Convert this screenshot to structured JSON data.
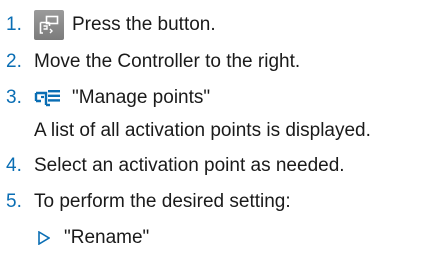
{
  "colors": {
    "accent": "#0a6eb4",
    "icon_fill": "#8a8a8a",
    "text": "#1a1a1a"
  },
  "steps": [
    {
      "number": "1.",
      "icon": "parking-assist-button-icon",
      "text": "Press the button."
    },
    {
      "number": "2.",
      "text": "Move the Controller to the right."
    },
    {
      "number": "3.",
      "icon": "parking-menu-icon",
      "text": "\"Manage points\""
    },
    {
      "number": "4.",
      "text": "Select an activation point as needed."
    },
    {
      "number": "5.",
      "text": "To perform the desired setting:"
    }
  ],
  "step3_note": "A list of all activation points is displayed.",
  "substeps": [
    {
      "icon": "triangle-bullet-icon",
      "text": "\"Rename\""
    }
  ]
}
